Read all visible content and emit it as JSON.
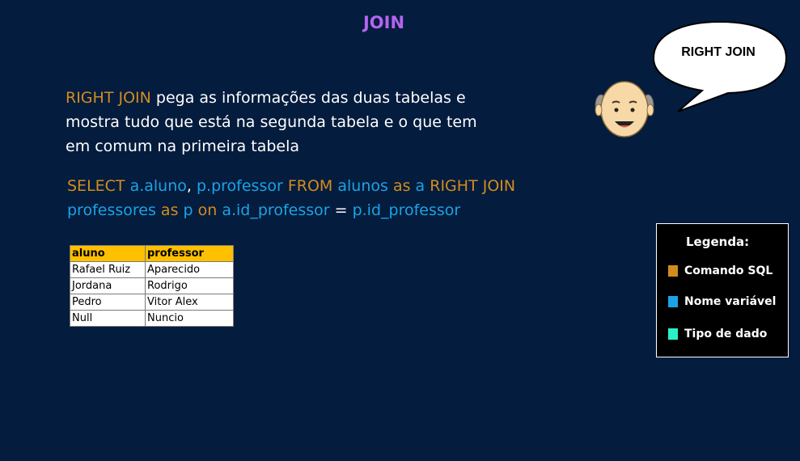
{
  "title": "JOIN",
  "description": {
    "highlight": "RIGHT JOIN",
    "line1_rest": " pega as informações das duas tabelas e",
    "line2": "mostra tudo que está na segunda tabela e o que tem",
    "line3": "em comum na primeira tabela"
  },
  "sql": {
    "select": "SELECT",
    "a_aluno": "a.aluno",
    "comma": ",",
    "p_professor": "p.professor",
    "from": "FROM",
    "alunos": "alunos",
    "as1": "as",
    "a": "a",
    "right_join": "RIGHT JOIN",
    "professores": "professores",
    "as2": "as",
    "p": "p",
    "on": "on",
    "a_id": "a.id_professor",
    "eq": "=",
    "p_id": "p.id_professor"
  },
  "table": {
    "headers": [
      "aluno",
      "professor"
    ],
    "rows": [
      [
        "Rafael Ruiz",
        "Aparecido"
      ],
      [
        "Jordana",
        "Rodrigo"
      ],
      [
        "Pedro",
        "Vitor Alex"
      ],
      [
        "Null",
        "Nuncio"
      ]
    ]
  },
  "bubble": {
    "text": "RIGHT JOIN"
  },
  "legend": {
    "title": "Legenda:",
    "items": [
      {
        "label": "Comando SQL",
        "color": "#d18c20"
      },
      {
        "label": "Nome variável",
        "color": "#1aa4e6"
      },
      {
        "label": "Tipo de dado",
        "color": "#2af0c8"
      }
    ]
  },
  "colors": {
    "background": "#041c3d",
    "title": "#b464f0",
    "command": "#d18c20",
    "variable": "#1aa4e6",
    "header_fill": "#ffc000"
  },
  "icons": [
    "speech-bubble-icon",
    "old-man-face-icon"
  ]
}
